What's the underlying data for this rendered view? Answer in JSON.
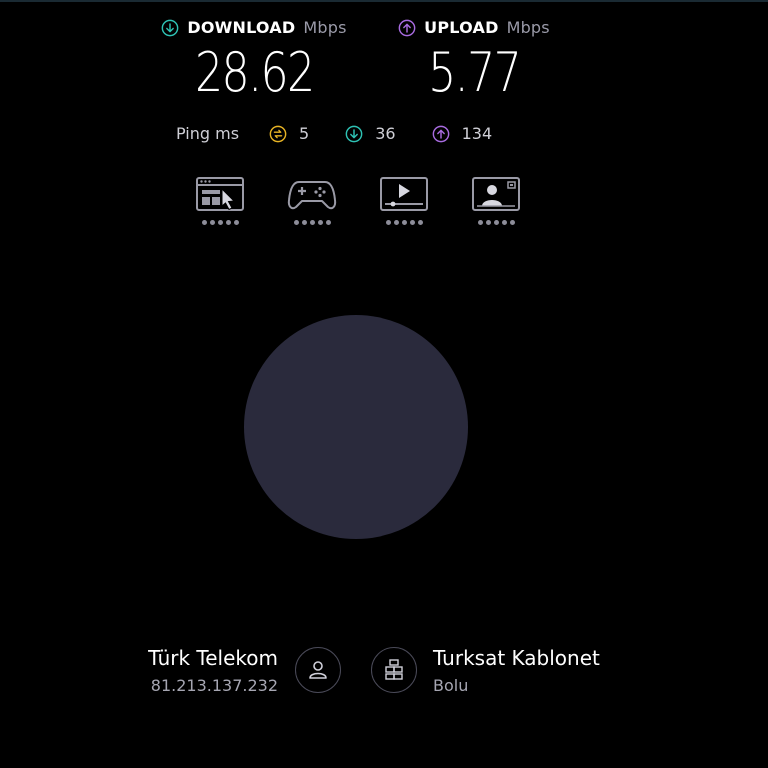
{
  "download": {
    "label": "DOWNLOAD",
    "unit": "Mbps",
    "value": "28.62",
    "icon": "download-arrow-icon",
    "color": "#2ec2b4"
  },
  "upload": {
    "label": "UPLOAD",
    "unit": "Mbps",
    "value": "5.77",
    "icon": "upload-arrow-icon",
    "color": "#a86be0"
  },
  "ping": {
    "label": "Ping ms",
    "idle": {
      "value": "5",
      "icon": "ping-idle-icon",
      "color": "#e7b324"
    },
    "download": {
      "value": "36",
      "icon": "download-arrow-icon",
      "color": "#2ec2b4"
    },
    "upload": {
      "value": "134",
      "icon": "upload-arrow-icon",
      "color": "#a86be0"
    }
  },
  "tiles": [
    {
      "name": "web-browsing",
      "icon": "browser-cursor-icon"
    },
    {
      "name": "gaming",
      "icon": "gamepad-icon"
    },
    {
      "name": "video-streaming",
      "icon": "video-player-icon"
    },
    {
      "name": "video-chat",
      "icon": "video-call-icon"
    }
  ],
  "isp": {
    "name": "Türk Telekom",
    "ip": "81.213.137.232",
    "icon": "user-icon"
  },
  "server": {
    "name": "Turksat Kablonet",
    "location": "Bolu",
    "icon": "server-icon"
  },
  "gauge_color": "#2a2a3c"
}
